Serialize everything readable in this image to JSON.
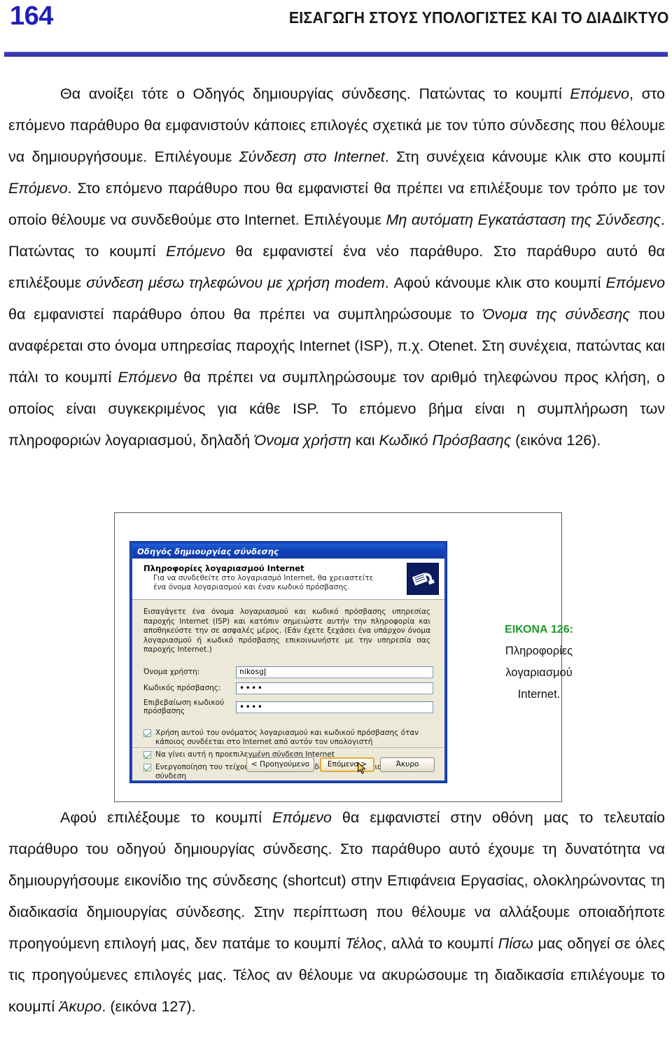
{
  "header": {
    "folio": "164",
    "title": "ΕΙΣΑΓΩΓΗ ΣΤΟΥΣ ΥΠΟΛΟΓΙΣΤΕΣ ΚΑΙ ΤΟ ΔΙΑΔΙΚΤΥΟ"
  },
  "paragraph_1": {
    "segments": [
      {
        "text": "Θα ανοίξει τότε ο Οδηγός δημιουργίας σύνδεσης. Πατώντας το κουμπί ",
        "style": "normal"
      },
      {
        "text": "Επόμενο",
        "style": "italic"
      },
      {
        "text": ", στο επόμενο παράθυρο θα εμφανιστούν κάποιες επιλογές σχετικά με τον τύπο σύνδεσης που θέλουμε να δημιουργήσουμε. Επιλέγουμε ",
        "style": "normal"
      },
      {
        "text": "Σύνδεση στο Internet",
        "style": "italic"
      },
      {
        "text": ". Στη συνέχεια κάνουμε κλικ στο κουμπί ",
        "style": "normal"
      },
      {
        "text": "Επόμενο",
        "style": "italic"
      },
      {
        "text": ". Στο επόμενο παράθυρο που θα εμφανιστεί θα πρέπει να επιλέξουμε τον τρόπο με τον οποίο θέλουμε να συνδεθούμε στο Internet. Επιλέγουμε ",
        "style": "normal"
      },
      {
        "text": "Μη αυτόματη Εγκατάσταση της Σύνδεσης",
        "style": "italic"
      },
      {
        "text": ".  Πατώντας το κουμπί ",
        "style": "normal"
      },
      {
        "text": "Επόμενο",
        "style": "italic"
      },
      {
        "text": " θα εμφανιστεί ένα νέο παράθυρο. Στο παράθυρο αυτό θα επιλέξουμε ",
        "style": "normal"
      },
      {
        "text": "σύνδεση μέσω τηλεφώνου με χρήση modem",
        "style": "italic"
      },
      {
        "text": ". Αφού κάνουμε κλικ στο κουμπί ",
        "style": "normal"
      },
      {
        "text": "Επόμενο",
        "style": "italic"
      },
      {
        "text": " θα εμφανιστεί παράθυρο όπου θα πρέπει να συμπληρώσουμε το ",
        "style": "normal"
      },
      {
        "text": "Όνομα της σύνδεσης",
        "style": "italic"
      },
      {
        "text": " που αναφέρεται στο όνομα υπηρεσίας παροχής Internet (ISP), π.χ. Otenet. Στη συνέχεια, πατώντας και πάλι το κουμπί ",
        "style": "normal"
      },
      {
        "text": "Επόμενο",
        "style": "italic"
      },
      {
        "text": " θα πρέπει να συμπληρώσουμε τον αριθμό τηλεφώνου προς κλήση, ο οποίος είναι συγκεκριμένος για κάθε ISP. Το επόμενο βήμα είναι η συμπλήρωση των πληροφοριών λογαριασμού, δηλαδή ",
        "style": "normal"
      },
      {
        "text": "Όνομα χρήστη",
        "style": "italic"
      },
      {
        "text": " και ",
        "style": "normal"
      },
      {
        "text": "Κωδικό Πρόσβασης",
        "style": "italic"
      },
      {
        "text": " (εικόνα 126).",
        "style": "normal"
      }
    ]
  },
  "paragraph_2": {
    "segments": [
      {
        "text": "Αφού επιλέξουμε το κουμπί ",
        "style": "normal"
      },
      {
        "text": "Επόμενο",
        "style": "italic"
      },
      {
        "text": " θα εμφανιστεί στην οθόνη μας το τελευταίο παράθυρο του οδηγού δημιουργίας σύνδεσης. Στο παράθυρο αυτό έχουμε τη δυνατότητα να δημιουργήσουμε εικονίδιο της σύνδεσης (shortcut) στην Επιφάνεια Εργασίας, ολοκληρώνοντας τη διαδικασία δημιουργίας σύνδεσης. Στην περίπτωση που θέλουμε να αλλάξουμε οποιαδήποτε προηγούμενη επιλογή μας, δεν πατάμε το κουμπί ",
        "style": "normal"
      },
      {
        "text": "Τέλος",
        "style": "italic"
      },
      {
        "text": ", αλλά το κουμπί ",
        "style": "normal"
      },
      {
        "text": "Πίσω",
        "style": "italic"
      },
      {
        "text": " μας οδηγεί σε όλες τις προηγούμενες επιλογές μας. Τέλος αν θέλουμε να ακυρώσουμε τη διαδικασία επιλέγουμε το κουμπί ",
        "style": "normal"
      },
      {
        "text": "Άκυρο",
        "style": "italic"
      },
      {
        "text": ". (εικόνα 127).",
        "style": "normal"
      }
    ]
  },
  "dialog": {
    "titlebar": "Οδηγός δημιουργίας σύνδεσης",
    "header_title": "Πληροφορίες λογαριασμού Internet",
    "header_sub": "Για να συνδεθείτε στο λογαριασμό Internet, θα χρειαστείτε ένα όνομα λογαριασμού και έναν κωδικό πρόσβασης.",
    "intro": "Εισαγάγετε ένα όνομα λογαριασμού και κωδικό πρόσβασης υπηρεσίας παροχής Internet (ISP) και κατόπιν σημειώστε αυτήν την πληροφορία και αποθηκεύστε την σε ασφαλές μέρος. (Εάν έχετε ξεχάσει ένα υπάρχον όνομα λογαριασμού ή κωδικό πρόσβασης επικοινωνήστε με την υπηρεσία σας παροχής Internet.)",
    "fields": [
      {
        "label": "Όνομα χρήστη:",
        "value": "nikosg",
        "type": "text"
      },
      {
        "label": "Κωδικός πρόσβασης:",
        "value": "••••",
        "type": "password"
      },
      {
        "label": "Επιβεβαίωση κωδικού πρόσβασης",
        "value": "••••",
        "type": "password"
      }
    ],
    "checkboxes": [
      {
        "label": "Χρήση αυτού του ονόματος λογαριασμού και κωδικού πρόσβασης όταν κάποιος συνδέεται στο Internet από αυτόν τον υπολογιστή",
        "checked": true
      },
      {
        "label": "Να γίνει αυτή η προεπιλεγμένη σύνδεση Internet",
        "checked": true
      },
      {
        "label": "Ενεργοποίηση του τείχους προστασίας σύνδεσης Internet για αυτήν τη σύνδεση",
        "checked": true
      }
    ],
    "buttons": {
      "back": "< Προηγούμενο",
      "next": "Επόμενο >",
      "cancel": "Άκυρο"
    }
  },
  "caption": {
    "label": "ΕΙΚΟΝΑ 126:",
    "line1": "Πληροφορίες",
    "line2": "λογαριασμού",
    "line3": "Internet."
  },
  "colors": {
    "folio": "#1f1fb4",
    "rule": "#3a3ab0",
    "caption_label": "#1f9a2e",
    "dialog_titlebar": "#1242b8",
    "dialog_body": "#ece9d8",
    "focus_border": "#e3a93a",
    "check_mark": "#3a9b3a"
  }
}
